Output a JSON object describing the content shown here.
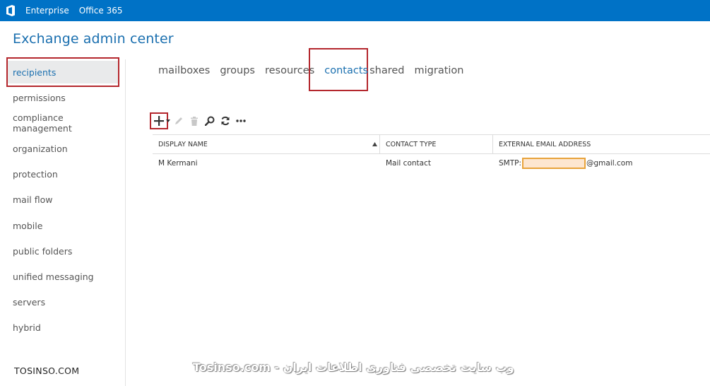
{
  "topbar": {
    "logo_icon": "office-logo-icon",
    "links": [
      {
        "label": "Enterprise"
      },
      {
        "label": "Office 365"
      }
    ],
    "color": "#0072c6"
  },
  "app": {
    "title": "Exchange admin center",
    "accent": "#1a6faf"
  },
  "sidebar": {
    "items": [
      {
        "label": "recipients",
        "selected": true
      },
      {
        "label": "permissions"
      },
      {
        "label": "compliance management"
      },
      {
        "label": "organization"
      },
      {
        "label": "protection"
      },
      {
        "label": "mail flow"
      },
      {
        "label": "mobile"
      },
      {
        "label": "public folders"
      },
      {
        "label": "unified messaging"
      },
      {
        "label": "servers"
      },
      {
        "label": "hybrid"
      }
    ]
  },
  "tabs": [
    {
      "label": "mailboxes"
    },
    {
      "label": "groups"
    },
    {
      "label": "resources"
    },
    {
      "label": "contacts",
      "active": true
    },
    {
      "label": "shared"
    },
    {
      "label": "migration"
    }
  ],
  "toolbar": {
    "icons": [
      "add-icon",
      "dropdown-arrow-icon",
      "edit-icon",
      "delete-icon",
      "search-icon",
      "refresh-icon",
      "more-icon"
    ]
  },
  "grid": {
    "columns": [
      {
        "label": "DISPLAY NAME",
        "sort": "ascending"
      },
      {
        "label": "CONTACT TYPE"
      },
      {
        "label": "EXTERNAL EMAIL ADDRESS"
      }
    ],
    "rows": [
      {
        "display_name": "M Kermani",
        "contact_type": "Mail contact",
        "email_prefix": "SMTP:",
        "email_suffix": "@gmail.com"
      }
    ]
  },
  "watermark": {
    "left_text": "TOSINSO.COM",
    "main_text": "Tosinso.com - وب سایت تخصصی فناوری اطلاعات ایران"
  }
}
